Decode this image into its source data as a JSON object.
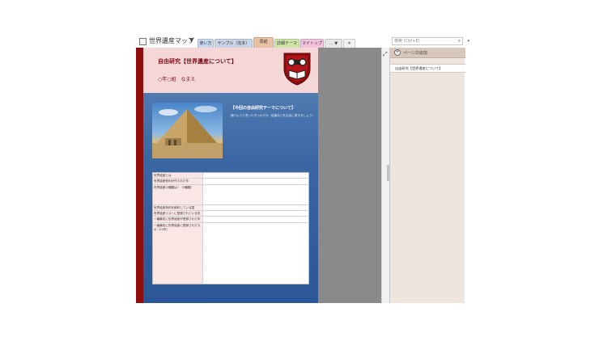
{
  "notebook": {
    "title": "世界遺産マップ",
    "caret": "▼"
  },
  "tabs": [
    {
      "label": "使い方",
      "color": "#c8d9f0"
    },
    {
      "label": "サンプル（完本）",
      "color": "#c9d4e8"
    },
    {
      "label": "原紙",
      "color": "#e9c2a4"
    },
    {
      "label": "詳細テーマ",
      "color": "#cfe6a8"
    },
    {
      "label": "マイトップ",
      "color": "#f3c2de"
    },
    {
      "label": "... ▼",
      "color": "#e7e7e7"
    },
    {
      "label": "＊",
      "color": "#f0f0f0"
    }
  ],
  "search": {
    "placeholder": "検索 (Ctrl+E)",
    "icon": "magnifier-icon"
  },
  "page": {
    "title": "自由研究【世界遺産について】",
    "subtitle": "○年○組　なまえ",
    "theme_title": "【今回の自由研究テーマについて】",
    "theme_text": "調べようと思ったきっかけや、結論などを自由に書きましょう！",
    "table": [
      {
        "label": "世界遺産とは",
        "lines": 1
      },
      {
        "label": "世界遺産条約が作られた年",
        "lines": 1
      },
      {
        "label": "世界遺産の種類は？（3種類）",
        "lines": 4
      },
      {
        "label": "世界遺産条約を締約している国",
        "lines": 1
      },
      {
        "label": "世界遺産リストに登録されている件数",
        "lines": 1
      },
      {
        "label": "一番最初に世界遺産が登録された年",
        "lines": 1
      },
      {
        "label": "一番最初に世界遺産に登録されたもの（12件）",
        "lines": 12
      }
    ],
    "dash": "-"
  },
  "sidebar": {
    "add_page_label": "ページの追加",
    "add_page_icon": "plus-circle-icon",
    "pages": [
      "自由研究【世界遺産について】"
    ]
  },
  "colors": {
    "accent_red": "#8d0c0d",
    "title_red": "#7a0a14",
    "header_pink": "#f6d7d8",
    "page_blue": "#3a67a3",
    "sidebar_bg": "#eee5df"
  }
}
